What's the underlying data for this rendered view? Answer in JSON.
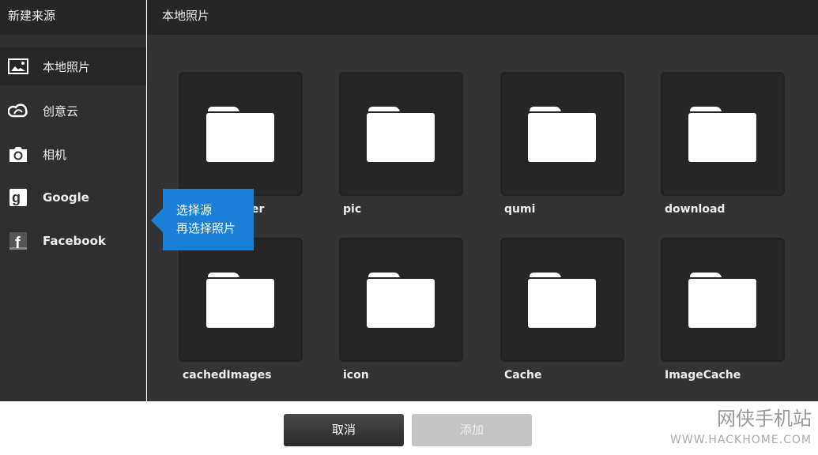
{
  "sidebar": {
    "title": "新建来源",
    "items": [
      {
        "label": "本地照片",
        "icon": "image-icon",
        "selected": true
      },
      {
        "label": "创意云",
        "icon": "creative-cloud-icon"
      },
      {
        "label": "相机",
        "icon": "camera-icon"
      },
      {
        "label": "Google",
        "icon": "google-icon"
      },
      {
        "label": "Facebook",
        "icon": "facebook-icon"
      }
    ]
  },
  "main": {
    "title": "本地照片",
    "folders": [
      {
        "label": "er"
      },
      {
        "label": "pic"
      },
      {
        "label": "qumi"
      },
      {
        "label": "download"
      },
      {
        "label": "cachedImages"
      },
      {
        "label": "icon"
      },
      {
        "label": "Cache"
      },
      {
        "label": "ImageCache"
      }
    ]
  },
  "tooltip": {
    "line1": "选择源",
    "line2": "再选择照片"
  },
  "buttons": {
    "cancel": "取消",
    "add": "添加"
  },
  "watermark": {
    "name": "网侠手机站",
    "url": "WWW.HACKHOME.COM"
  },
  "colors": {
    "accent": "#1a7fd6"
  }
}
